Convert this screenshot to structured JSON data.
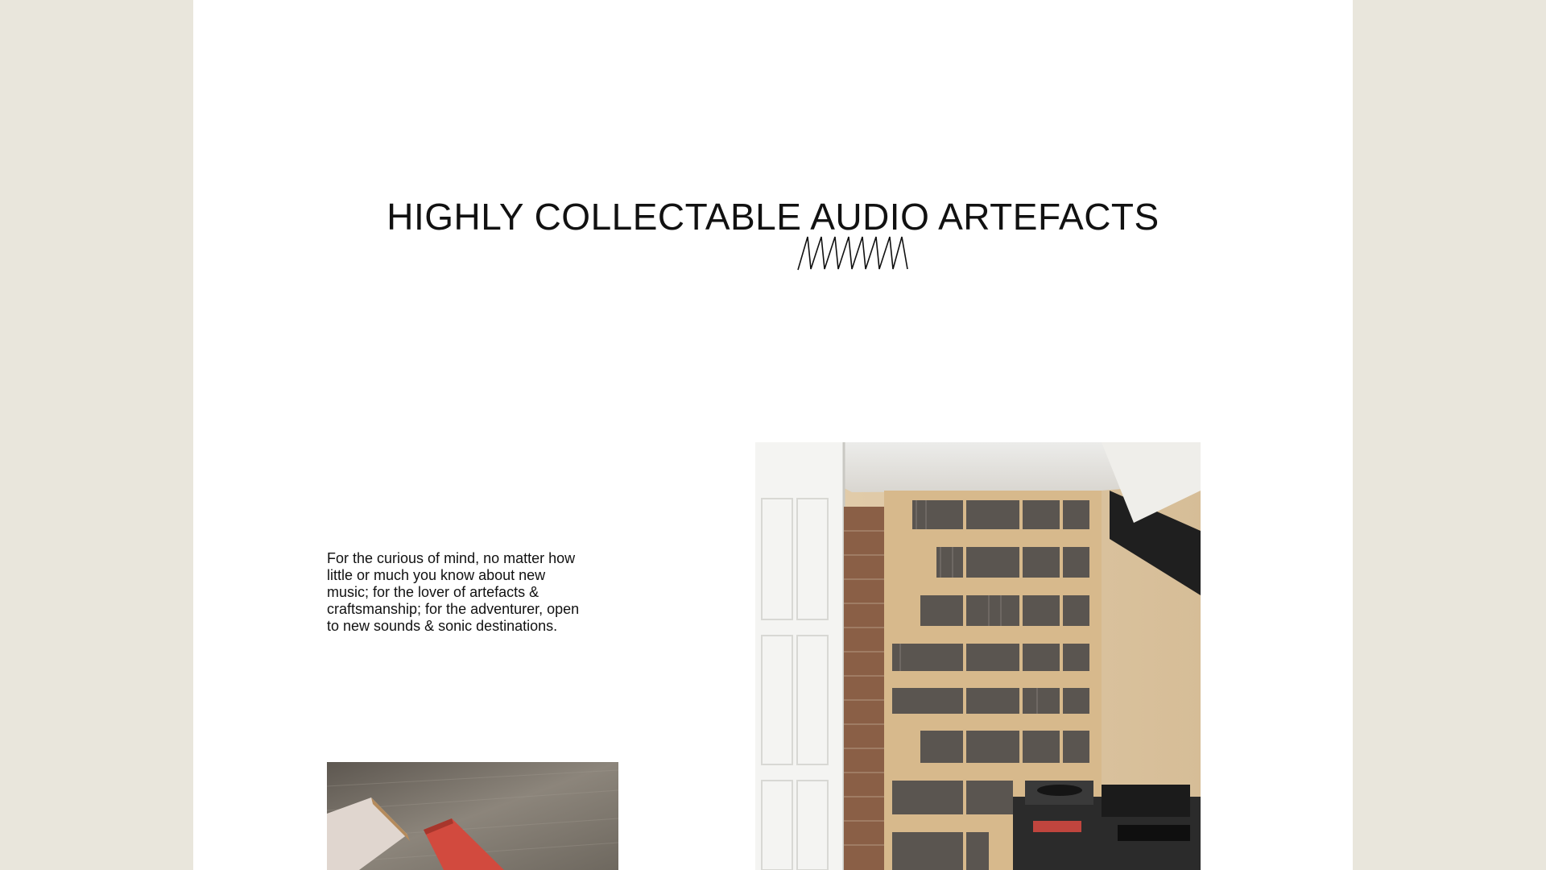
{
  "hero": {
    "headline": "HIGHLY COLLECTABLE AUDIO ARTEFACTS",
    "ornament_icon": "zigzag-waveform-icon"
  },
  "intro": {
    "text": "For the curious of mind, no matter how little or much you know about new music; for the lover of artefacts & craftsmanship; for the adventurer, open to new sounds & sonic destinations."
  },
  "images": {
    "records_room": "record-shelves-dj-room-photo",
    "furniture_detail": "wood-and-red-furniture-detail-photo"
  },
  "colors": {
    "page_background": "#e9e6dc",
    "content_background": "#ffffff",
    "text": "#111111"
  }
}
